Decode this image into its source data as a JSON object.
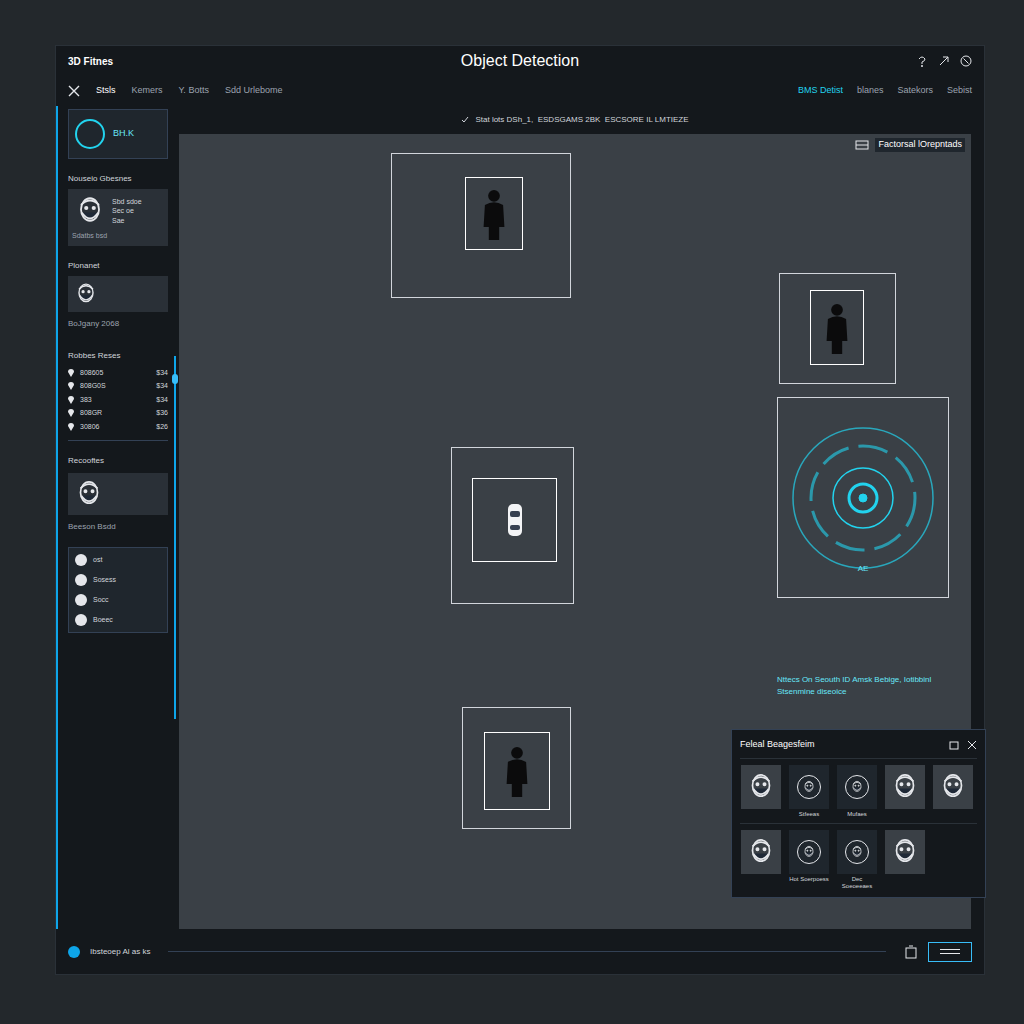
{
  "window": {
    "logo": "3D Fitnes",
    "title": "Object Detection"
  },
  "tabs_left": [
    {
      "label": "Stsls",
      "selected": true
    },
    {
      "label": "Kemers",
      "selected": false
    },
    {
      "label": "Y. Botts",
      "selected": false
    },
    {
      "label": "Sdd Urlebome",
      "selected": false
    }
  ],
  "tabs_right": [
    {
      "label": "BMS Detist",
      "selected": true
    },
    {
      "label": "blanes",
      "selected": false
    },
    {
      "label": "Satekors",
      "selected": false
    },
    {
      "label": "Sebist",
      "selected": false
    }
  ],
  "info_line": "Stat lots DSh_1,  ESDSGAMS 2BK  ESCSORE IL LMTIEZE",
  "map_label": "Factorsal lOrepntads",
  "map_note": [
    "Nttecs On Seouth ID Amsk Bebige, Iotibbinl",
    "Stsenmine diseoice"
  ],
  "detections": [
    {
      "kind": "person"
    },
    {
      "kind": "person"
    },
    {
      "kind": "scan",
      "label": "AE"
    },
    {
      "kind": "vehicle"
    },
    {
      "kind": "person"
    }
  ],
  "sidebar": {
    "top_card": {
      "reading": "BH.K"
    },
    "sections": [
      {
        "title": "Nouseio Gbesnes",
        "lines": [
          "Sbd sdoe",
          "Sec oe",
          "Sae"
        ],
        "footer": "Sdatbs bsd"
      },
      {
        "title": "Plonanet",
        "lines": [],
        "footer": ""
      }
    ],
    "caption": "BoJgany 2068",
    "list_title": "Robbes Reses",
    "rows": [
      {
        "code": "808605",
        "value": "$34"
      },
      {
        "code": "808G0S",
        "value": "$34"
      },
      {
        "code": "383",
        "value": "$34"
      },
      {
        "code": "808GR",
        "value": "$36"
      },
      {
        "code": "30806",
        "value": "$26"
      }
    ],
    "second_title": "Recooftes",
    "second_caption": "Beeson Bsdd",
    "people": [
      {
        "label": "ost"
      },
      {
        "label": "Sosess"
      },
      {
        "label": "Socc"
      },
      {
        "label": "Boeec"
      }
    ],
    "scroll_level": 0.05
  },
  "face_panel": {
    "title": "Feleal Beagesfeim",
    "rows": [
      [
        {
          "kind": "photo"
        },
        {
          "kind": "avatar",
          "label": "Stfeeas"
        },
        {
          "kind": "avatar",
          "label": "Mufaes"
        },
        {
          "kind": "photo"
        },
        {
          "kind": "photo"
        }
      ],
      [
        {
          "kind": "photo"
        },
        {
          "kind": "avatar",
          "label": "Hot Soerpoess"
        },
        {
          "kind": "avatar",
          "label": "Dec Soeoeeaes"
        },
        {
          "kind": "photo"
        }
      ]
    ]
  },
  "status_bar": {
    "text": "Ibsteoep Al as ks"
  }
}
